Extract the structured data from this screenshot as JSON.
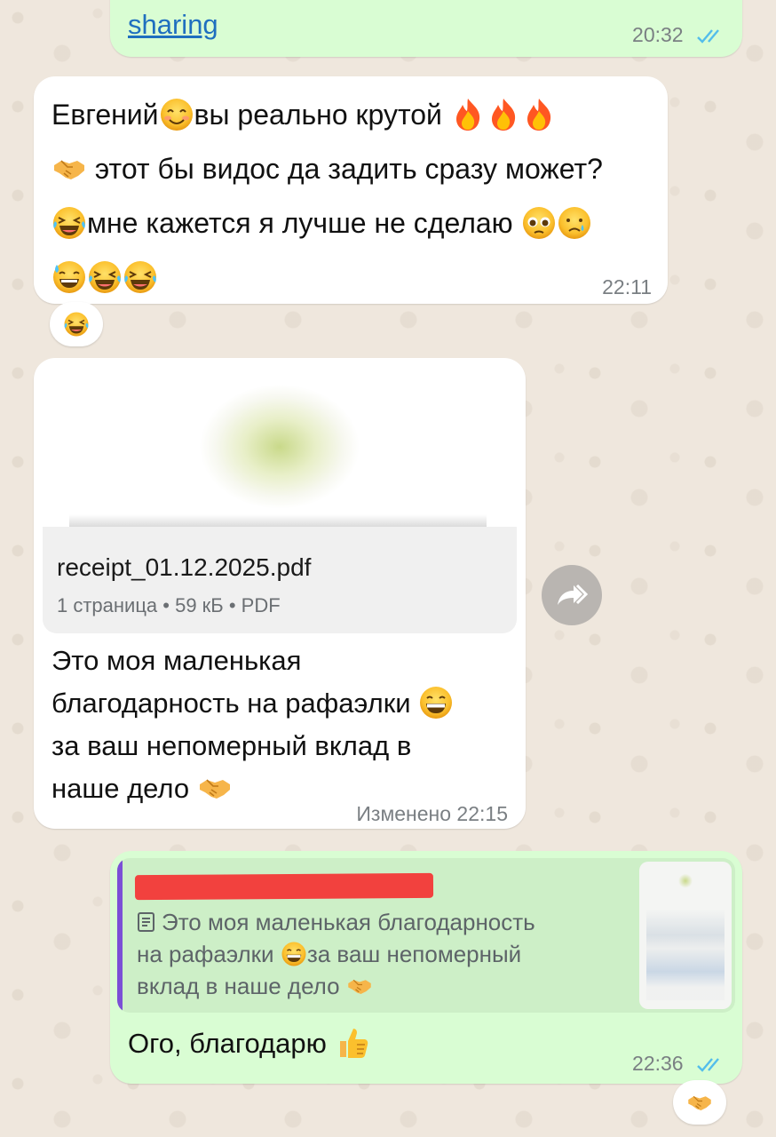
{
  "messages": {
    "m1": {
      "link_text": "sharing",
      "time": "20:32"
    },
    "m2": {
      "line1_a": "Евгений",
      "line1_b": "вы реально крутой",
      "line2": "этот бы видос да задить сразу может?",
      "line3": "мне кажется я лучше не сделаю",
      "time": "22:11",
      "reaction": "laughing-tears-emoji"
    },
    "m3": {
      "file_name": "receipt_01.12.2025.pdf",
      "file_meta": "1 страница • 59 кБ • PDF",
      "line1": "Это моя маленькая",
      "line2": "благодарность на рафаэлки",
      "line3": "за ваш непомерный вклад в",
      "line4": "наше дело",
      "time": "Изменено 22:15"
    },
    "m4": {
      "quote_line1": "Это моя маленькая благодарность",
      "quote_line2_a": "на рафаэлки",
      "quote_line2_b": "за ваш непомерный",
      "quote_line3": "вклад в наше дело",
      "text": "Ого, благодарю",
      "time": "22:36",
      "reaction": "handshake-emoji"
    }
  },
  "colors": {
    "outgoing": "#d9fdd3",
    "incoming": "#ffffff",
    "link": "#1f6fbf",
    "read_ticks": "#53bdeb",
    "quote_bar": "#7b4fd6",
    "redaction": "#f2413e"
  },
  "icons": {
    "forward": "forward-icon",
    "document": "document-icon",
    "read_receipt": "double-check-icon"
  }
}
